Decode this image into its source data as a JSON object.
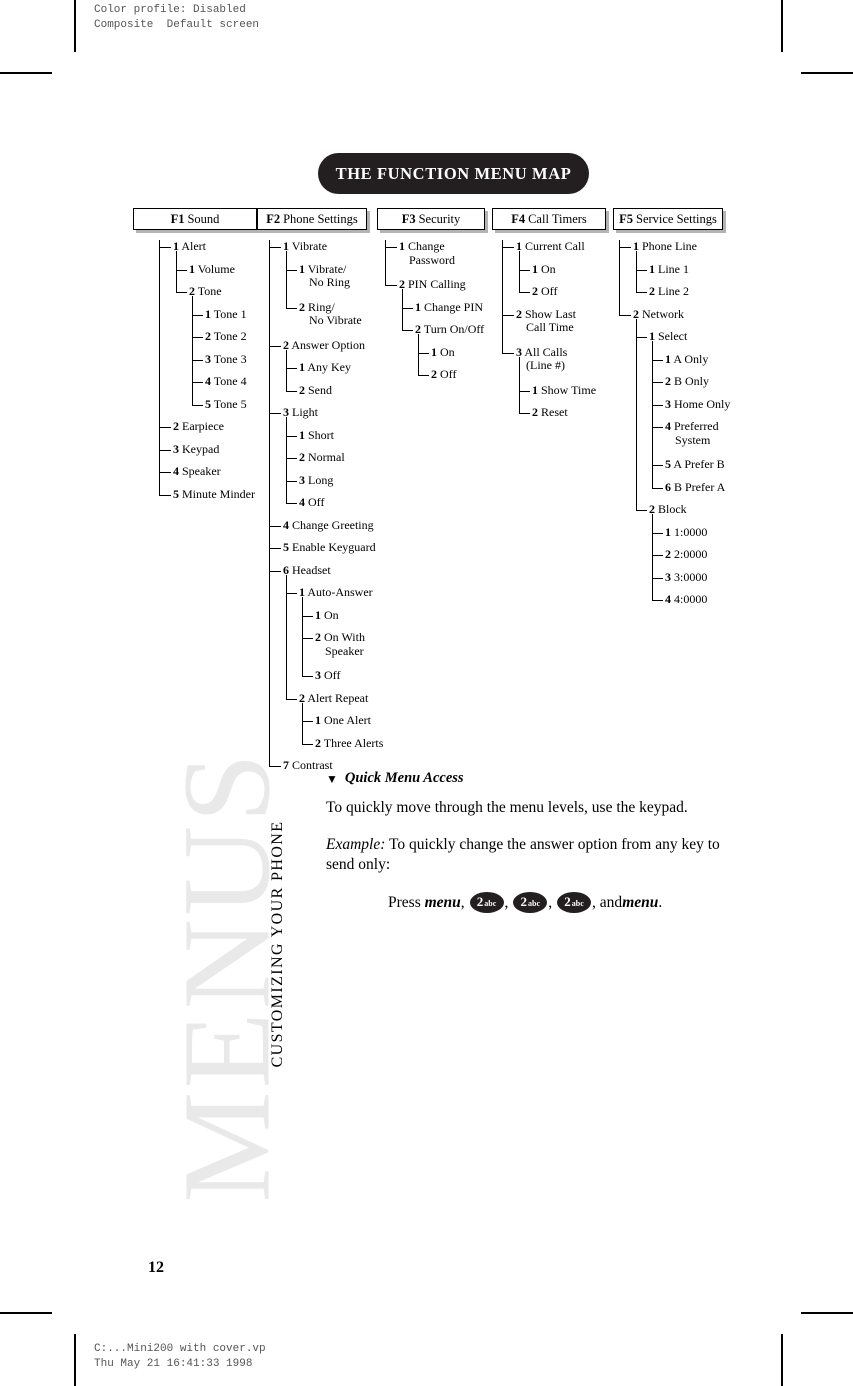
{
  "slug": {
    "top": "Color profile: Disabled\nComposite  Default screen",
    "bottom": "C:...Mini200 with cover.vp\nThu May 21 16:41:33 1998"
  },
  "title": "THE FUNCTION MENU MAP",
  "page_number": "12",
  "running_head": "CUSTOMIZING YOUR PHONE",
  "watermark": "MENUS",
  "colors": {
    "pill_background": "#231f20",
    "header_shadow": "#b3b3b3",
    "watermark": "#e9e9e9",
    "ink": "#000000"
  },
  "menu_map": {
    "columns": [
      {
        "key": "F1",
        "title": "Sound",
        "items": [
          {
            "num": "1",
            "label": "Alert",
            "children": [
              {
                "num": "1",
                "label": "Volume"
              },
              {
                "num": "2",
                "label": "Tone",
                "children": [
                  {
                    "num": "1",
                    "label": "Tone 1"
                  },
                  {
                    "num": "2",
                    "label": "Tone 2"
                  },
                  {
                    "num": "3",
                    "label": "Tone 3"
                  },
                  {
                    "num": "4",
                    "label": "Tone 4"
                  },
                  {
                    "num": "5",
                    "label": "Tone 5"
                  }
                ]
              }
            ]
          },
          {
            "num": "2",
            "label": "Earpiece"
          },
          {
            "num": "3",
            "label": "Keypad"
          },
          {
            "num": "4",
            "label": "Speaker"
          },
          {
            "num": "5",
            "label": "Minute Minder"
          }
        ]
      },
      {
        "key": "F2",
        "title": "Phone Settings",
        "items": [
          {
            "num": "1",
            "label": "Vibrate",
            "children": [
              {
                "num": "1",
                "label": "Vibrate/",
                "label2": "No Ring"
              },
              {
                "num": "2",
                "label": "Ring/",
                "label2": "No Vibrate"
              }
            ]
          },
          {
            "num": "2",
            "label": "Answer Option",
            "children": [
              {
                "num": "1",
                "label": "Any Key"
              },
              {
                "num": "2",
                "label": "Send"
              }
            ]
          },
          {
            "num": "3",
            "label": "Light",
            "children": [
              {
                "num": "1",
                "label": "Short"
              },
              {
                "num": "2",
                "label": "Normal"
              },
              {
                "num": "3",
                "label": "Long"
              },
              {
                "num": "4",
                "label": "Off"
              }
            ]
          },
          {
            "num": "4",
            "label": "Change Greeting"
          },
          {
            "num": "5",
            "label": "Enable Keyguard"
          },
          {
            "num": "6",
            "label": "Headset",
            "children": [
              {
                "num": "1",
                "label": "Auto-Answer",
                "children": [
                  {
                    "num": "1",
                    "label": "On"
                  },
                  {
                    "num": "2",
                    "label": "On With",
                    "label2": "Speaker"
                  },
                  {
                    "num": "3",
                    "label": "Off"
                  }
                ]
              },
              {
                "num": "2",
                "label": "Alert Repeat",
                "children": [
                  {
                    "num": "1",
                    "label": "One Alert"
                  },
                  {
                    "num": "2",
                    "label": "Three Alerts"
                  }
                ]
              }
            ]
          },
          {
            "num": "7",
            "label": "Contrast"
          }
        ]
      },
      {
        "key": "F3",
        "title": "Security",
        "items": [
          {
            "num": "1",
            "label": "Change",
            "label2": "Password"
          },
          {
            "num": "2",
            "label": "PIN Calling",
            "children": [
              {
                "num": "1",
                "label": "Change PIN"
              },
              {
                "num": "2",
                "label": "Turn On/Off",
                "children": [
                  {
                    "num": "1",
                    "label": "On"
                  },
                  {
                    "num": "2",
                    "label": "Off"
                  }
                ]
              }
            ]
          }
        ]
      },
      {
        "key": "F4",
        "title": "Call Timers",
        "items": [
          {
            "num": "1",
            "label": "Current Call",
            "children": [
              {
                "num": "1",
                "label": "On"
              },
              {
                "num": "2",
                "label": "Off"
              }
            ]
          },
          {
            "num": "2",
            "label": "Show Last",
            "label2": "Call Time"
          },
          {
            "num": "3",
            "label": "All Calls",
            "label2": "(Line #)",
            "children": [
              {
                "num": "1",
                "label": "Show Time"
              },
              {
                "num": "2",
                "label": "Reset"
              }
            ]
          }
        ]
      },
      {
        "key": "F5",
        "title": "Service Settings",
        "items": [
          {
            "num": "1",
            "label": "Phone Line",
            "children": [
              {
                "num": "1",
                "label": "Line 1"
              },
              {
                "num": "2",
                "label": "Line 2"
              }
            ]
          },
          {
            "num": "2",
            "label": "Network",
            "children": [
              {
                "num": "1",
                "label": "Select",
                "children": [
                  {
                    "num": "1",
                    "label": "A Only"
                  },
                  {
                    "num": "2",
                    "label": "B Only"
                  },
                  {
                    "num": "3",
                    "label": "Home Only"
                  },
                  {
                    "num": "4",
                    "label": "Preferred",
                    "label2": "System"
                  },
                  {
                    "num": "5",
                    "label": "A Prefer B"
                  },
                  {
                    "num": "6",
                    "label": "B Prefer A"
                  }
                ]
              },
              {
                "num": "2",
                "label": "Block",
                "children": [
                  {
                    "num": "1",
                    "label": "1:0000"
                  },
                  {
                    "num": "2",
                    "label": "2:0000"
                  },
                  {
                    "num": "3",
                    "label": "3:0000"
                  },
                  {
                    "num": "4",
                    "label": "4:0000"
                  }
                ]
              }
            ]
          }
        ]
      }
    ]
  },
  "copy": {
    "heading_marker": "▼",
    "heading": "Quick Menu Access",
    "paragraph1": "To quickly move through the menu levels, use the keypad.",
    "example_label": "Example:",
    "example_text": " To quickly change the answer option from any key to send only:",
    "press_word": "Press",
    "menu_key": "menu",
    "comma": ",",
    "keys": [
      {
        "num": "2",
        "abc": "abc"
      },
      {
        "num": "2",
        "abc": "abc"
      },
      {
        "num": "2",
        "abc": "abc"
      }
    ],
    "and_word": ", and ",
    "menu_key_end": "menu",
    "period": "."
  }
}
